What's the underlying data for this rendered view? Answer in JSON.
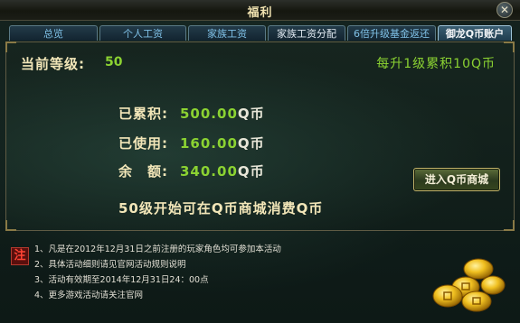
{
  "window": {
    "title": "福利"
  },
  "tabs": [
    {
      "label": "总览",
      "state": "inactive"
    },
    {
      "label": "个人工资",
      "state": "inactive"
    },
    {
      "label": "家族工资",
      "state": "inactive"
    },
    {
      "label": "家族工资分配",
      "state": "plain"
    },
    {
      "label": "6倍升级基金返还",
      "state": "inactive"
    },
    {
      "label": "御龙Q币账户",
      "state": "active"
    }
  ],
  "account": {
    "level_label": "当前等级:",
    "level_value": "50",
    "per_level_note": "每升1级累积10Q币",
    "accumulated_label": "已累积:",
    "accumulated_value": "500.00",
    "used_label": "已使用:",
    "used_value": "160.00",
    "balance_label": "余　额:",
    "balance_value": "340.00",
    "unit": "Q币",
    "usage_notice": "50级开始可在Q币商城消费Q币",
    "shop_button": "进入Q币商城"
  },
  "notes": {
    "badge": "注",
    "items": [
      "1、凡是在2012年12月31日之前注册的玩家角色均可参加本活动",
      "2、具体活动细则请见官网活动规则说明",
      "3、活动有效期至2014年12月31日24：00点",
      "4、更多游戏活动请关注官网"
    ]
  },
  "colors": {
    "accent_green": "#8bd232",
    "label_gold": "#f2e6b8",
    "tab_blue": "#7fc0e6"
  },
  "icons": {
    "close": "close-icon",
    "coins": "gold-coins-icon"
  }
}
